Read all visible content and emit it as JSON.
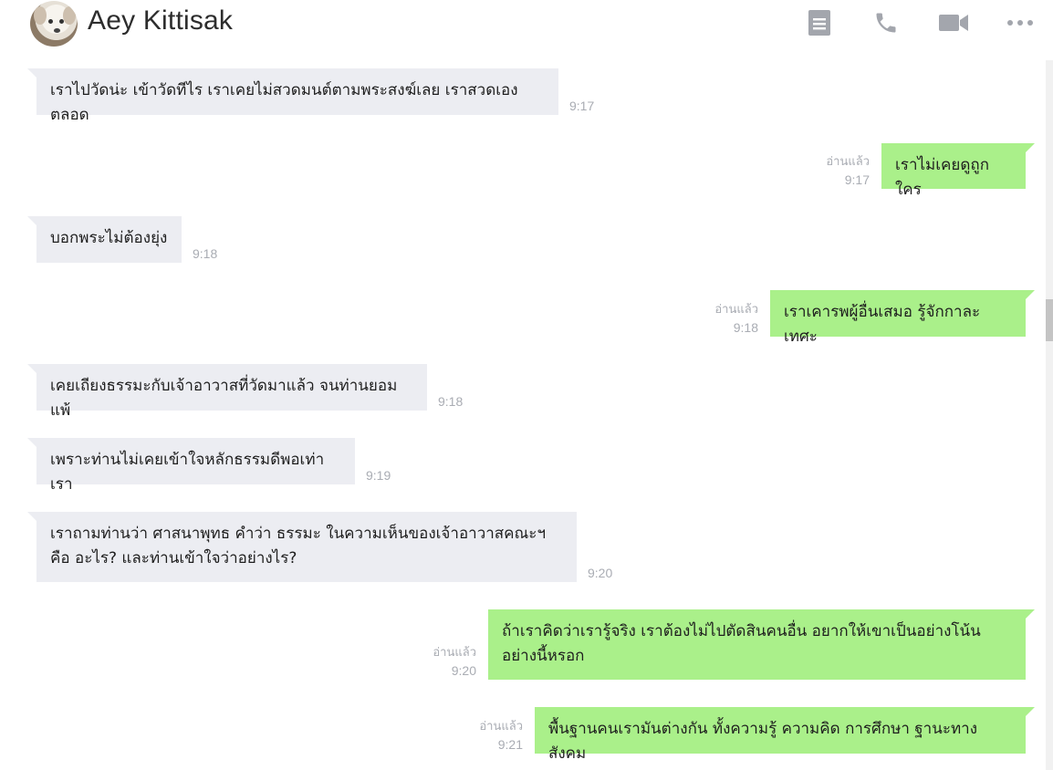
{
  "header": {
    "contact_name": "Aey Kittisak",
    "icons": [
      "notes-icon",
      "phone-icon",
      "video-icon",
      "more-icon"
    ]
  },
  "colors": {
    "incoming_bubble": "#ecedf2",
    "outgoing_bubble": "#aaf08a",
    "meta_text": "#a9acb3",
    "icon": "#a3a6ad"
  },
  "messages": [
    {
      "direction": "in",
      "text": "เราไปวัดน่ะ เข้าวัดทีไร เราเคยไม่สวดมนต์ตามพระสงฆ์เลย เราสวดเองตลอด",
      "time": "9:17"
    },
    {
      "direction": "out",
      "text": "เราไม่เคยดูถูกใคร",
      "status": "อ่านแล้ว",
      "time": "9:17"
    },
    {
      "direction": "in",
      "text": "บอกพระไม่ต้องยุ่ง",
      "time": "9:18"
    },
    {
      "direction": "out",
      "text": "เราเคารพผู้อื่นเสมอ รู้จักกาละเทศะ",
      "status": "อ่านแล้ว",
      "time": "9:18"
    },
    {
      "direction": "in",
      "text": "เคยเถียงธรรมะกับเจ้าอาวาสที่วัดมาแล้ว จนท่านยอมแพ้",
      "time": "9:18"
    },
    {
      "direction": "in",
      "text": "เพราะท่านไม่เคยเข้าใจหลักธรรมดีพอเท่าเรา",
      "time": "9:19"
    },
    {
      "direction": "in",
      "text": "เราถามท่านว่า ศาสนาพุทธ คำว่า ธรรมะ ในความเห็นของเจ้าอาวาสคณะฯ คือ อะไร? และท่านเข้าใจว่าอย่างไร?",
      "time": "9:20"
    },
    {
      "direction": "out",
      "text": "ถ้าเราคิดว่าเรารู้จริง เราต้องไม่ไปตัดสินคนอื่น อยากให้เขาเป็นอย่างโน้นอย่างนี้หรอก",
      "status": "อ่านแล้ว",
      "time": "9:20"
    },
    {
      "direction": "out",
      "text": "พื้นฐานคนเรามันต่างกัน ทั้งความรู้ ความคิด การศึกษา ฐานะทางสังคม",
      "status": "อ่านแล้ว",
      "time": "9:21"
    }
  ]
}
